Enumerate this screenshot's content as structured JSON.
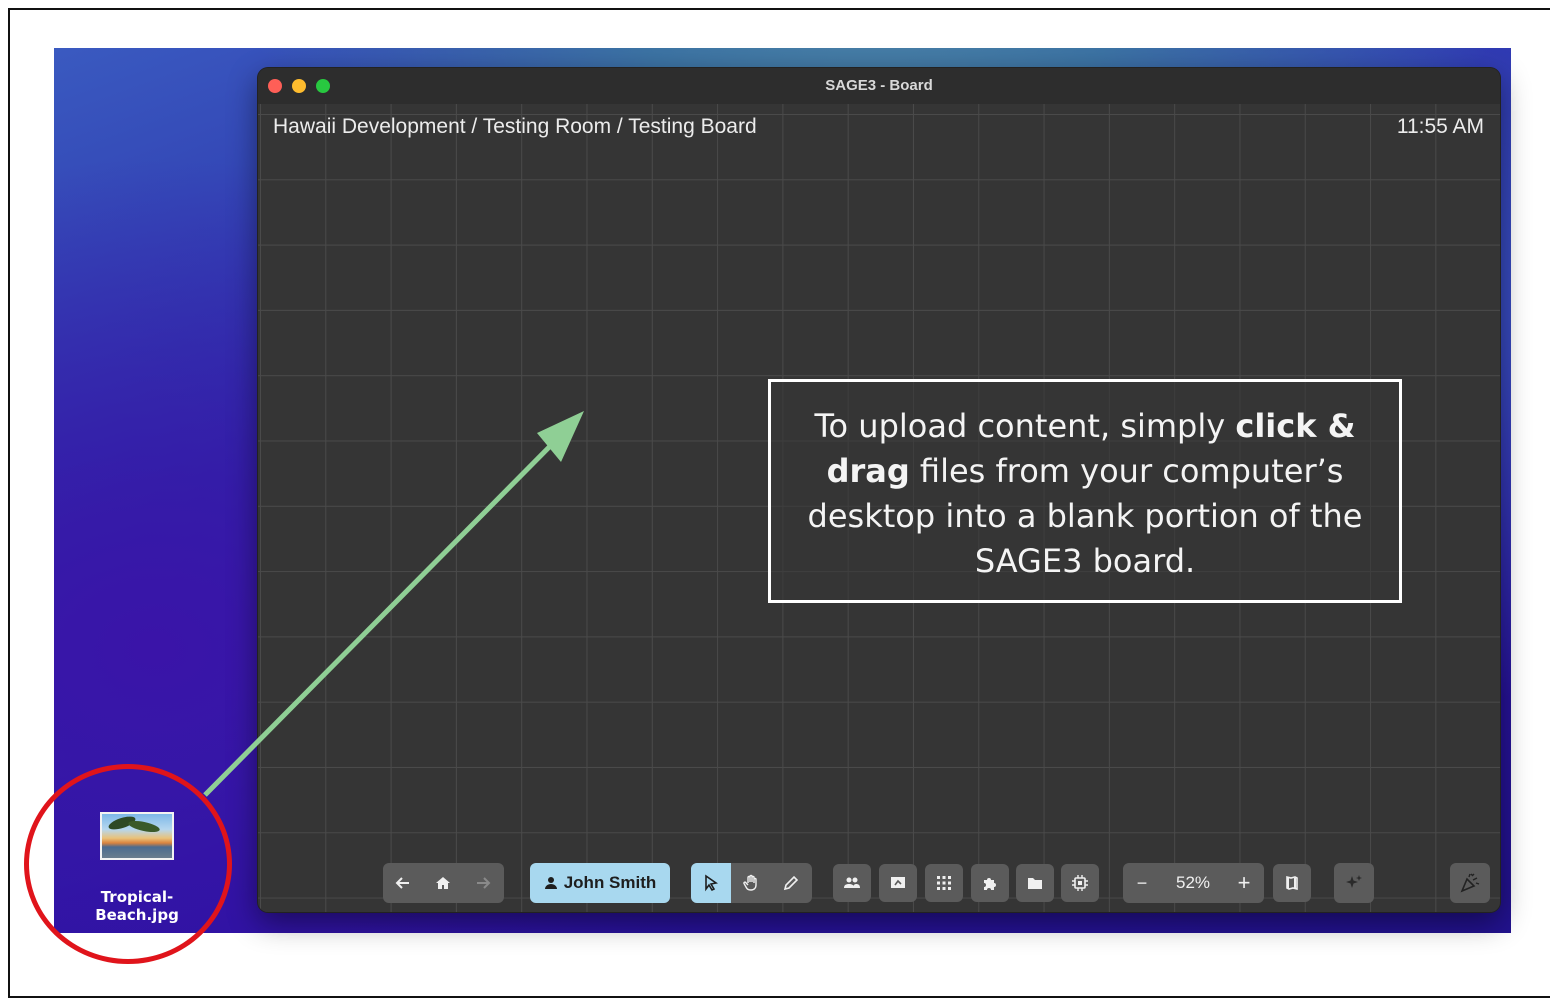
{
  "window": {
    "title": "SAGE3 - Board",
    "breadcrumb": "Hawaii Development / Testing Room / Testing Board",
    "clock": "11:55 AM"
  },
  "callout": {
    "text_1": "To upload content, simply ",
    "bold_1": "click &",
    "bold_2": "drag",
    "text_2": " files from your computer’s desktop into a blank portion of the SAGE3 board."
  },
  "desktop": {
    "file_name": "Tropical-Beach.jpg"
  },
  "toolbar": {
    "back_icon": "arrow-left-icon",
    "home_icon": "home-icon",
    "forward_icon": "arrow-right-icon",
    "user_label": "John Smith",
    "user_icon": "person-icon",
    "select_icon": "pointer-icon",
    "grab_icon": "hand-icon",
    "pen_icon": "pencil-icon",
    "zoom_minus": "−",
    "zoom_level": "52%",
    "zoom_plus": "+"
  },
  "colors": {
    "annotation_arrow": "#8fcf95",
    "annotation_circle": "#e0141b",
    "user_button": "#a8d8ef",
    "ai_button": "#b8b3e6",
    "party_button": "#a9e2c2"
  }
}
